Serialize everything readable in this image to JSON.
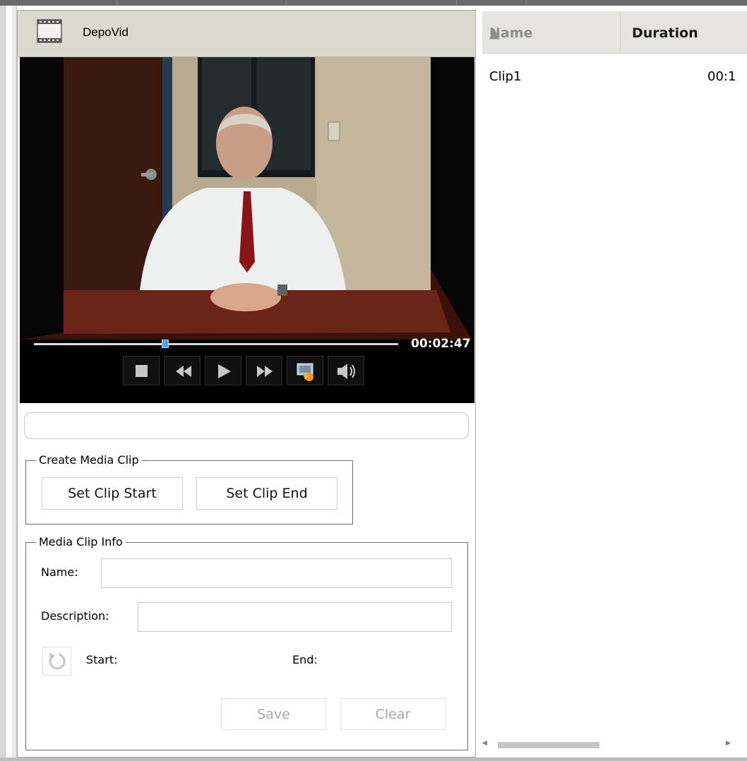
{
  "app": {
    "title": "DepoVid",
    "icon": "film-strip-icon"
  },
  "player": {
    "time": "00:02:47",
    "progress": 0.36,
    "controls": [
      "stop-icon",
      "rewind-icon",
      "play-icon",
      "fast-forward-icon",
      "snapshot-icon",
      "volume-icon"
    ]
  },
  "path_field": {
    "value": ""
  },
  "create_clip": {
    "legend": "Create Media Clip",
    "set_start_label": "Set Clip Start",
    "set_end_label": "Set Clip End"
  },
  "clip_info": {
    "legend": "Media Clip Info",
    "name_label": "Name:",
    "name_value": "",
    "description_label": "Description:",
    "description_value": "",
    "start_label": "Start:",
    "end_label": "End:",
    "save_label": "Save",
    "clear_label": "Clear"
  },
  "grid": {
    "columns": [
      "Name",
      "Duration"
    ],
    "rows": [
      {
        "name": "Clip1",
        "duration": "00:1"
      }
    ]
  }
}
